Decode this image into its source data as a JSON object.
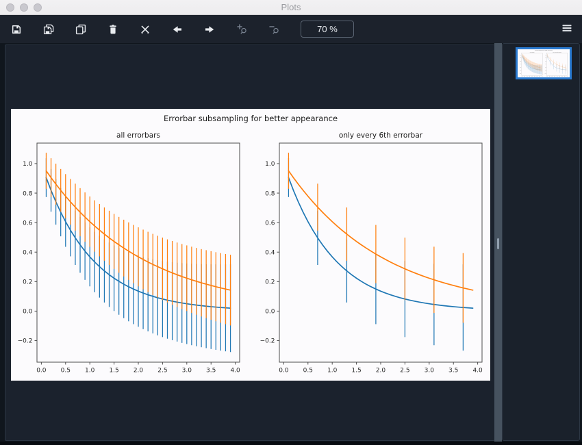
{
  "window": {
    "title": "Plots"
  },
  "toolbar": {
    "zoom_level": "70 %",
    "icons": [
      "save-icon",
      "save-all-icon",
      "copy-icon",
      "trash-icon",
      "close-all-icon",
      "arrow-left-icon",
      "arrow-right-icon",
      "zoom-in-icon",
      "zoom-out-icon",
      "menu-icon"
    ]
  },
  "colors": {
    "figure_bg": "#fcfbfd",
    "series_blue": "#1f77b4",
    "series_orange": "#ff7f0e",
    "thumbnail_selection": "#2a7ad0",
    "spine": "#4d4d4d",
    "figure_text": "#1a1a1a",
    "tick_text": "#262626"
  },
  "thumbnails": [
    {
      "selected": true
    }
  ],
  "chart_data": {
    "type": "line",
    "title": "Errorbar subsampling for better appearance",
    "grid": false,
    "legend": "none",
    "subplots": [
      {
        "title": "all errorbars",
        "errorevery": 1
      },
      {
        "title": "only every 6th errorbar",
        "errorevery": 6
      }
    ],
    "xlim": [
      -0.09,
      4.09
    ],
    "ylim": [
      -0.346,
      1.139
    ],
    "xticks": [
      0.0,
      0.5,
      1.0,
      1.5,
      2.0,
      2.5,
      3.0,
      3.5,
      4.0
    ],
    "yticks": [
      -0.2,
      0.0,
      0.2,
      0.4,
      0.6,
      0.8,
      1.0
    ],
    "x": [
      0.1,
      0.2,
      0.3,
      0.4,
      0.5,
      0.6,
      0.7,
      0.8,
      0.9,
      1.0,
      1.1,
      1.2,
      1.3,
      1.4,
      1.5,
      1.6,
      1.7,
      1.8,
      1.9,
      2.0,
      2.1,
      2.2,
      2.3,
      2.4,
      2.5,
      2.6,
      2.7,
      2.8,
      2.9,
      3.0,
      3.1,
      3.2,
      3.3,
      3.4,
      3.5,
      3.6,
      3.7,
      3.8,
      3.9
    ],
    "series": [
      {
        "color": "#1f77b4",
        "values": [
          0.9048,
          0.8187,
          0.7408,
          0.6703,
          0.6065,
          0.5488,
          0.4966,
          0.4493,
          0.4066,
          0.3679,
          0.3329,
          0.3012,
          0.2725,
          0.2466,
          0.2231,
          0.2019,
          0.1827,
          0.1653,
          0.1496,
          0.1353,
          0.1225,
          0.1108,
          0.1003,
          0.0907,
          0.0821,
          0.0743,
          0.0672,
          0.0608,
          0.055,
          0.0498,
          0.045,
          0.0408,
          0.0369,
          0.0334,
          0.0302,
          0.0273,
          0.0247,
          0.0224,
          0.0202
        ],
        "yerr": [
          0.1316,
          0.1447,
          0.1548,
          0.1632,
          0.1707,
          0.1775,
          0.1837,
          0.1894,
          0.1949,
          0.2,
          0.2049,
          0.2095,
          0.214,
          0.2183,
          0.2225,
          0.2265,
          0.2304,
          0.2342,
          0.2379,
          0.2414,
          0.2449,
          0.2483,
          0.2517,
          0.2549,
          0.2581,
          0.2612,
          0.2643,
          0.2673,
          0.2703,
          0.2732,
          0.2761,
          0.2789,
          0.2817,
          0.2844,
          0.2871,
          0.2897,
          0.2924,
          0.2949,
          0.2975
        ]
      },
      {
        "color": "#ff7f0e",
        "values": [
          0.9512,
          0.9048,
          0.8607,
          0.8187,
          0.7788,
          0.7408,
          0.7047,
          0.6703,
          0.6376,
          0.6065,
          0.5769,
          0.5488,
          0.522,
          0.4966,
          0.4724,
          0.4493,
          0.4274,
          0.4066,
          0.3867,
          0.3679,
          0.3499,
          0.3329,
          0.3166,
          0.3012,
          0.2865,
          0.2725,
          0.2592,
          0.2466,
          0.2346,
          0.2231,
          0.2122,
          0.2019,
          0.192,
          0.1827,
          0.1738,
          0.1653,
          0.1572,
          0.1496,
          0.1423
        ],
        "yerr": [
          0.1224,
          0.1316,
          0.1387,
          0.1447,
          0.15,
          0.1548,
          0.1592,
          0.1632,
          0.1671,
          0.1707,
          0.1742,
          0.1775,
          0.1806,
          0.1837,
          0.1866,
          0.1894,
          0.1922,
          0.1949,
          0.1975,
          0.2,
          0.2025,
          0.2049,
          0.2072,
          0.2095,
          0.2118,
          0.214,
          0.2162,
          0.2183,
          0.2204,
          0.2225,
          0.2245,
          0.2265,
          0.2285,
          0.2304,
          0.2324,
          0.2342,
          0.2361,
          0.2379,
          0.2397
        ]
      }
    ]
  }
}
